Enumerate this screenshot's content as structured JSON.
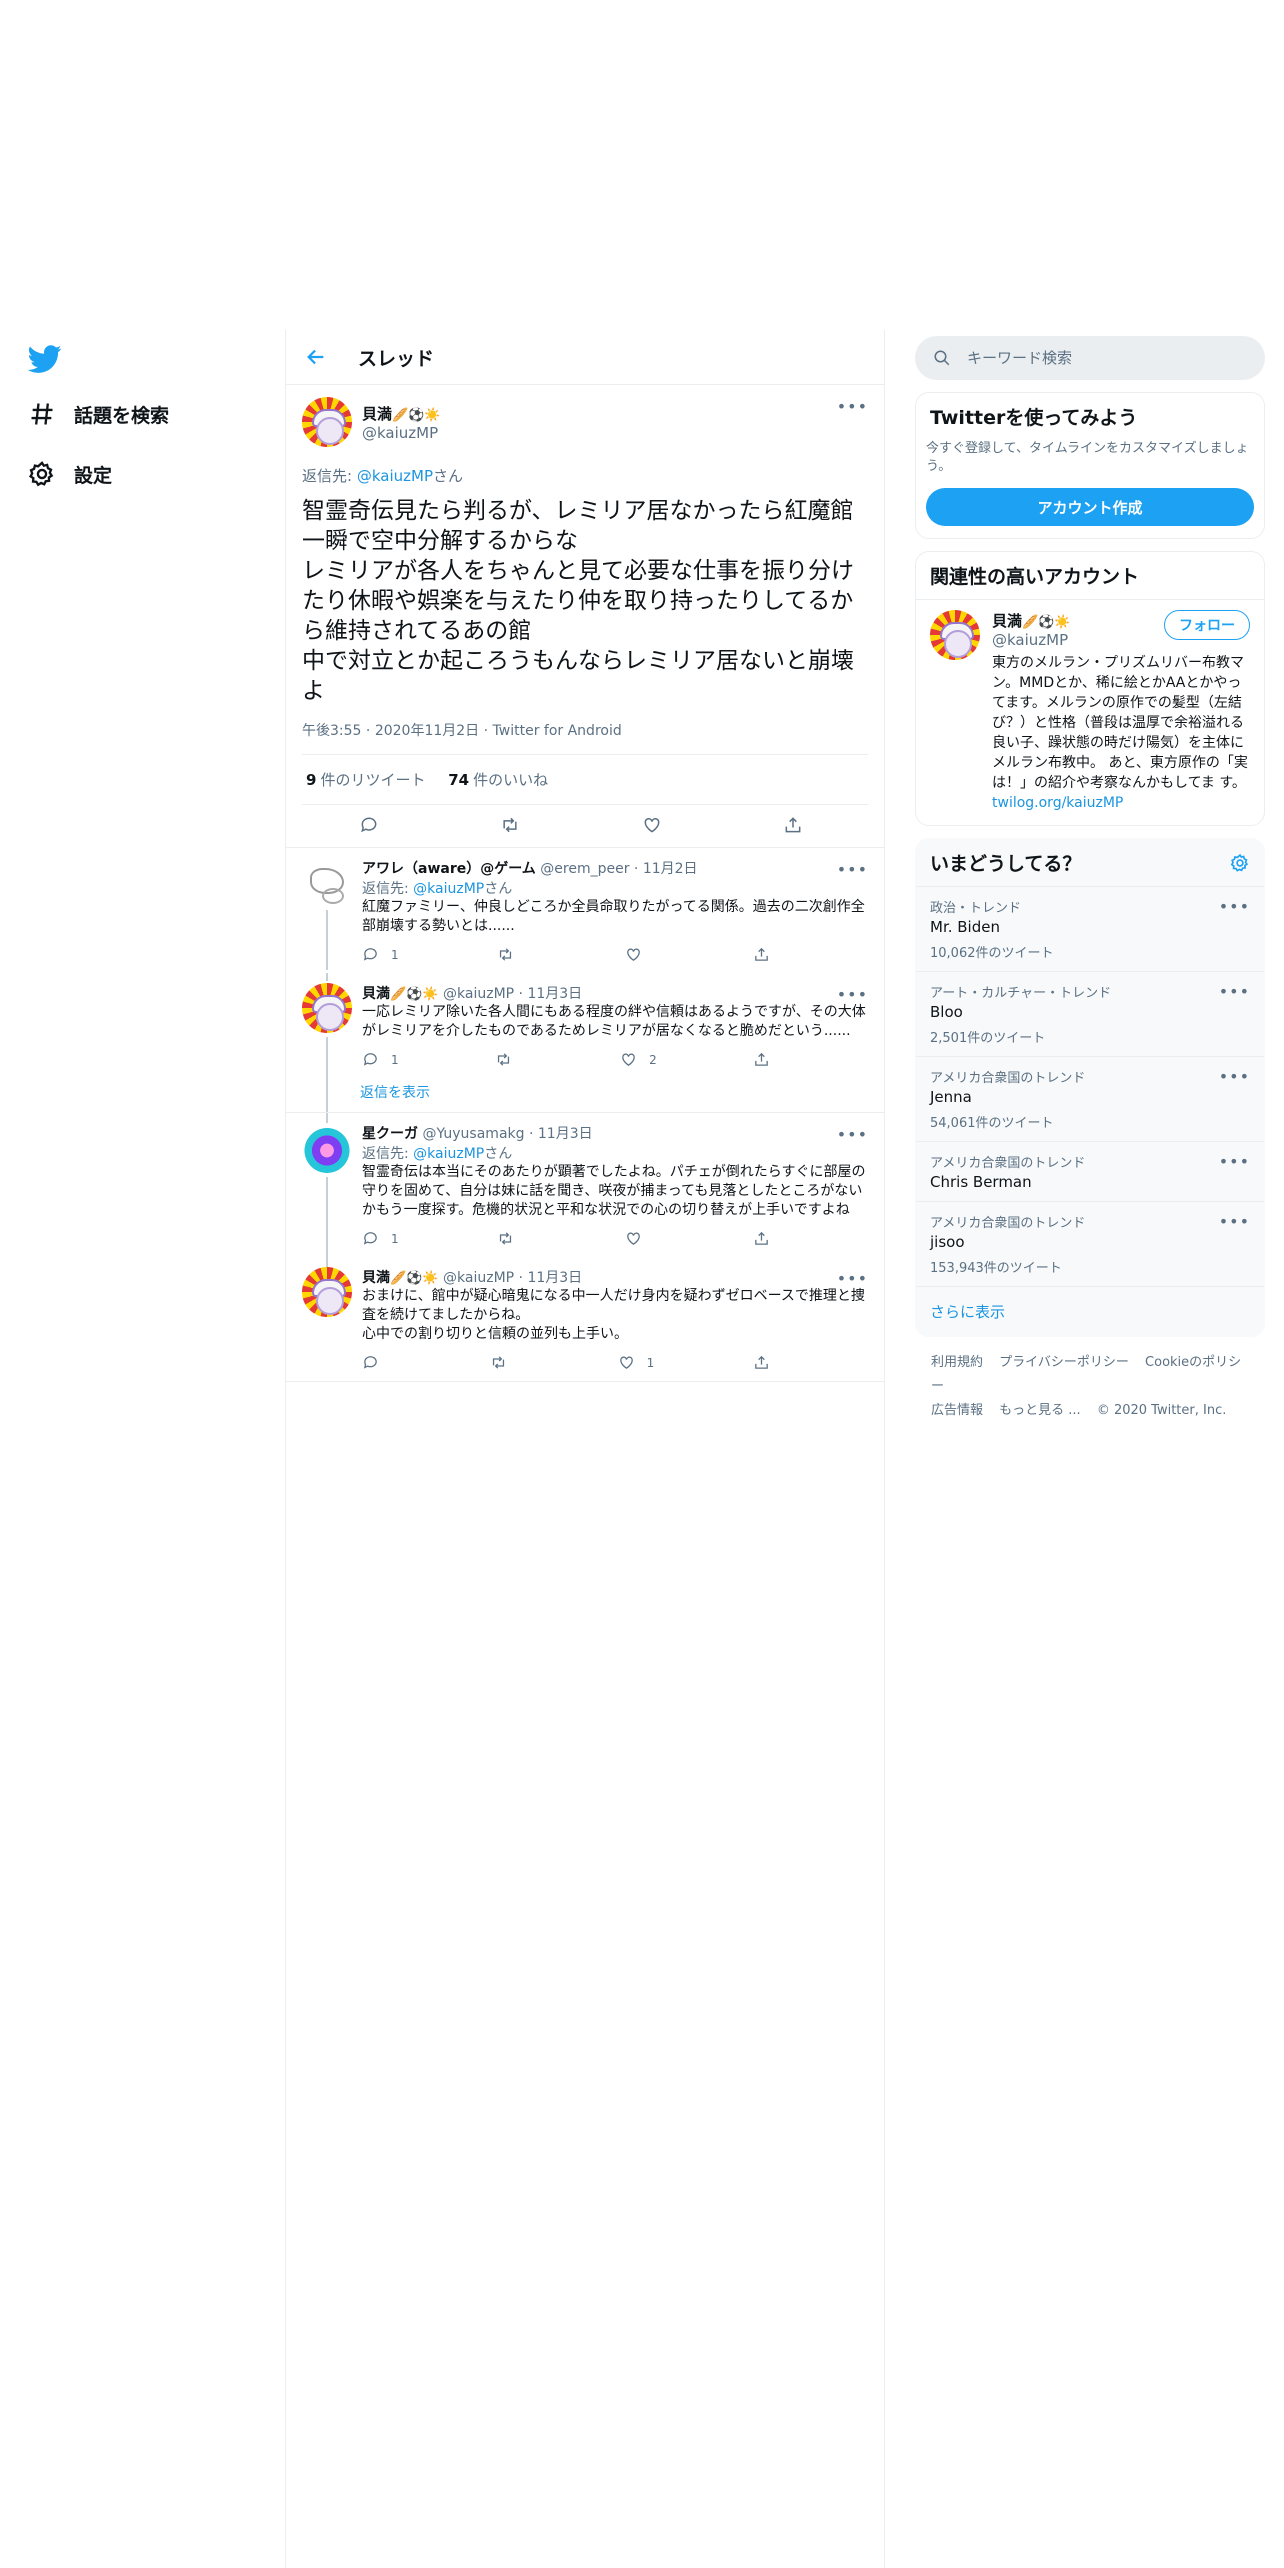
{
  "nav": {
    "explore_label": "話題を検索",
    "settings_label": "設定"
  },
  "header": {
    "title": "スレッド"
  },
  "main_tweet": {
    "display_name": "貝満",
    "name_emojis": "🥖⚽☀️",
    "handle": "@kaiuzMP",
    "reply_to_prefix": "返信先:",
    "reply_to_handle": "@kaiuzMP",
    "reply_to_suffix": "さん",
    "body": "智霊奇伝見たら判るが、レミリア居なかったら紅魔館一瞬で空中分解するからな\nレミリアが各人をちゃんと見て必要な仕事を振り分けたり休暇や娯楽を与えたり仲を取り持ったりしてるから維持されてるあの館\n中で対立とか起ころうもんならレミリア居ないと崩壊よ",
    "time": "午後3:55",
    "date": "2020年11月2日",
    "source": "Twitter for Android",
    "retweets_count": "9",
    "retweets_label": "件のリツイート",
    "likes_count": "74",
    "likes_label": "件のいいね",
    "more_label": "•••"
  },
  "replies": [
    {
      "display_name": "アワレ（aware）@ゲーム",
      "handle": "@erem_peer",
      "dot": "·",
      "time": "11月2日",
      "reply_to_prefix": "返信先:",
      "reply_to_handle": "@kaiuzMP",
      "reply_to_suffix": "さん",
      "body": "紅魔ファミリー、仲良しどころか全員命取りたがってる関係。過去の二次創作全部崩壊する勢いとは......",
      "reply_count": "1",
      "retweet_count": "",
      "like_count": ""
    },
    {
      "display_name": "貝満",
      "name_emojis": "🥖⚽☀️",
      "handle": "@kaiuzMP",
      "dot": "·",
      "time": "11月3日",
      "body": "一応レミリア除いた各人間にもある程度の絆や信頼はあるようですが、その大体がレミリアを介したものであるためレミリアが居なくなると脆めだという......",
      "reply_count": "1",
      "retweet_count": "",
      "like_count": "2"
    },
    {
      "display_name": "星クーガ",
      "handle": "@Yuyusamakg",
      "dot": "·",
      "time": "11月3日",
      "reply_to_prefix": "返信先:",
      "reply_to_handle": "@kaiuzMP",
      "reply_to_suffix": "さん",
      "body": "智霊奇伝は本当にそのあたりが顕著でしたよね。パチェが倒れたらすぐに部屋の守りを固めて、自分は妹に話を聞き、咲夜が捕まっても見落としたところがないかもう一度探す。危機的状況と平和な状況での心の切り替えが上手いですよね",
      "reply_count": "1",
      "retweet_count": "",
      "like_count": ""
    },
    {
      "display_name": "貝満",
      "name_emojis": "🥖⚽☀️",
      "handle": "@kaiuzMP",
      "dot": "·",
      "time": "11月3日",
      "body": "おまけに、館中が疑心暗鬼になる中一人だけ身内を疑わずゼロベースで推理と捜査を続けてましたからね。\n心中での割り切りと信頼の並列も上手い。",
      "reply_count": "",
      "retweet_count": "",
      "like_count": "1"
    }
  ],
  "show_replies_label": "返信を表示",
  "search": {
    "placeholder": "キーワード検索"
  },
  "signup": {
    "title": "Twitterを使ってみよう",
    "desc": "今すぐ登録して、タイムラインをカスタマイズしましょう。",
    "button": "アカウント作成"
  },
  "related": {
    "title": "関連性の高いアカウント",
    "display_name": "貝満",
    "name_emojis": "🥖⚽☀️",
    "handle": "@kaiuzMP",
    "follow_label": "フォロー",
    "bio": "東方のメルラン・プリズムリバー布教マン。MMDとか、稀に絵とかAAとかやってます。メルランの原作での髪型（左結び？）と性格（普段は温厚で余裕溢れる良い子、躁状態の時だけ陽気）を主体にメルラン布教中。 あと、東方原作の「実は！」の紹介や考察なんかもしてま す。",
    "link": "twilog.org/kaiuzMP"
  },
  "trends": {
    "title": "いまどうしてる？",
    "items": [
      {
        "category": "政治・トレンド",
        "name": "Mr. Biden",
        "count": "10,062件のツイート"
      },
      {
        "category": "アート・カルチャー・トレンド",
        "name": "Bloo",
        "count": "2,501件のツイート"
      },
      {
        "category": "アメリカ合衆国のトレンド",
        "name": "Jenna",
        "count": "54,061件のツイート"
      },
      {
        "category": "アメリカ合衆国のトレンド",
        "name": "Chris Berman",
        "count": ""
      },
      {
        "category": "アメリカ合衆国のトレンド",
        "name": "jisoo",
        "count": "153,943件のツイート"
      }
    ],
    "show_more": "さらに表示"
  },
  "footer": {
    "terms": "利用規約",
    "privacy": "プライバシーポリシー",
    "cookie": "Cookieのポリシー",
    "ads": "広告情報",
    "more": "もっと見る ...",
    "copyright": "© 2020 Twitter, Inc."
  },
  "colors": {
    "accent": "#1da1f2",
    "link": "#1b95e0",
    "muted": "#5b7083",
    "border": "#ebeef0"
  }
}
